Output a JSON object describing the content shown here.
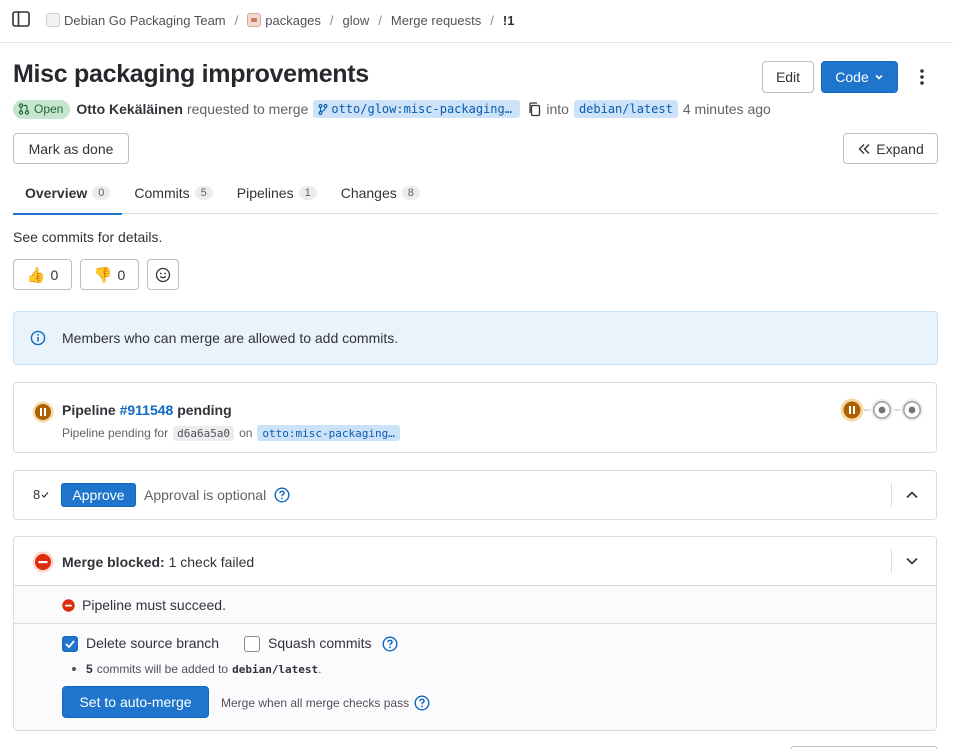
{
  "breadcrumb": {
    "items": [
      "Debian Go Packaging Team",
      "packages",
      "glow",
      "Merge requests",
      "!1"
    ],
    "separator": "/"
  },
  "mr": {
    "title": "Misc packaging improvements",
    "status": "Open",
    "author": "Otto Kekäläinen",
    "requested_text": "requested to merge",
    "source_branch": "otto/glow:misc-packaging…",
    "into_text": "into",
    "target_branch": "debian/latest",
    "time": "4 minutes ago"
  },
  "actions": {
    "edit": "Edit",
    "code": "Code",
    "mark_done": "Mark as done",
    "expand": "Expand"
  },
  "tabs": [
    {
      "label": "Overview",
      "count": "0"
    },
    {
      "label": "Commits",
      "count": "5"
    },
    {
      "label": "Pipelines",
      "count": "1"
    },
    {
      "label": "Changes",
      "count": "8"
    }
  ],
  "description": "See commits for details.",
  "reactions": {
    "thumbs_up": "0",
    "thumbs_down": "0"
  },
  "alert": {
    "text": "Members who can merge are allowed to add commits."
  },
  "pipeline": {
    "title_prefix": "Pipeline",
    "id": "#911548",
    "status_text": "pending",
    "sub_prefix": "Pipeline pending for",
    "sha": "d6a6a5a0",
    "on_text": "on",
    "branch": "otto:misc-packaging…"
  },
  "approval": {
    "count": "8",
    "button": "Approve",
    "text": "Approval is optional"
  },
  "merge": {
    "blocked_label": "Merge blocked:",
    "blocked_detail": "1 check failed",
    "check_text": "Pipeline must succeed.",
    "delete_source": "Delete source branch",
    "squash": "Squash commits",
    "commits_count": "5",
    "commits_text": "commits will be added to",
    "target": "debian/latest",
    "period": ".",
    "auto_merge_button": "Set to auto-merge",
    "help_text": "Merge when all merge checks pass"
  },
  "colors": {
    "primary": "#1f75cb",
    "pending": "#ab6100",
    "danger": "#dd2b0e",
    "open_badge": "#c3e6cd"
  }
}
